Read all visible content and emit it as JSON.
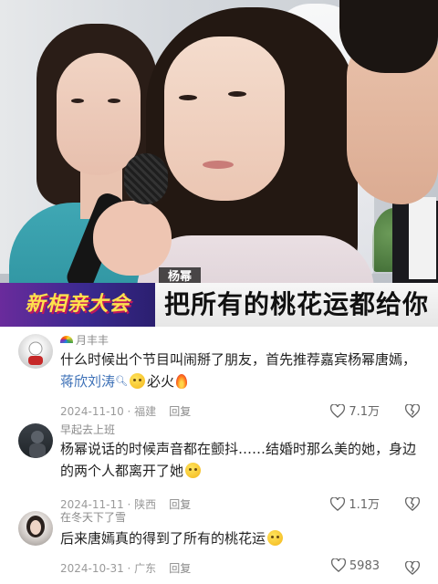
{
  "video": {
    "name_tag": "杨幂",
    "show_logo": "新相亲大会",
    "caption": "把所有的桃花运都给你"
  },
  "comments": [
    {
      "user": "月丰丰",
      "text_before": "什么时候出个节目叫闹掰了朋友，首先推荐嘉宾杨幂唐嫣，",
      "mention": "蒋欣刘涛",
      "text_after": "必火",
      "date": "2024-11-10 · 福建",
      "reply": "回复",
      "likes": "7.1万"
    },
    {
      "user": "早起去上班",
      "text": "杨幂说话的时候声音都在颤抖……结婚时那么美的她，身边的两个人都离开了她",
      "date": "2024-11-11 · 陕西",
      "reply": "回复",
      "likes": "1.1万"
    },
    {
      "user": "在冬天下了雪",
      "text": "后来唐嫣真的得到了所有的桃花运",
      "date": "2024-10-31 · 广东",
      "reply": "回复",
      "likes": "5983"
    }
  ],
  "colors": {
    "mention": "#3b6fb6",
    "meta": "#9a9a9a",
    "caption_bg": "#efefef"
  },
  "icons": [
    "heart-icon",
    "broken-heart-icon",
    "smile-emoji-icon",
    "fire-emoji-icon",
    "rainbow-emoji-icon",
    "pleading-emoji-icon"
  ]
}
